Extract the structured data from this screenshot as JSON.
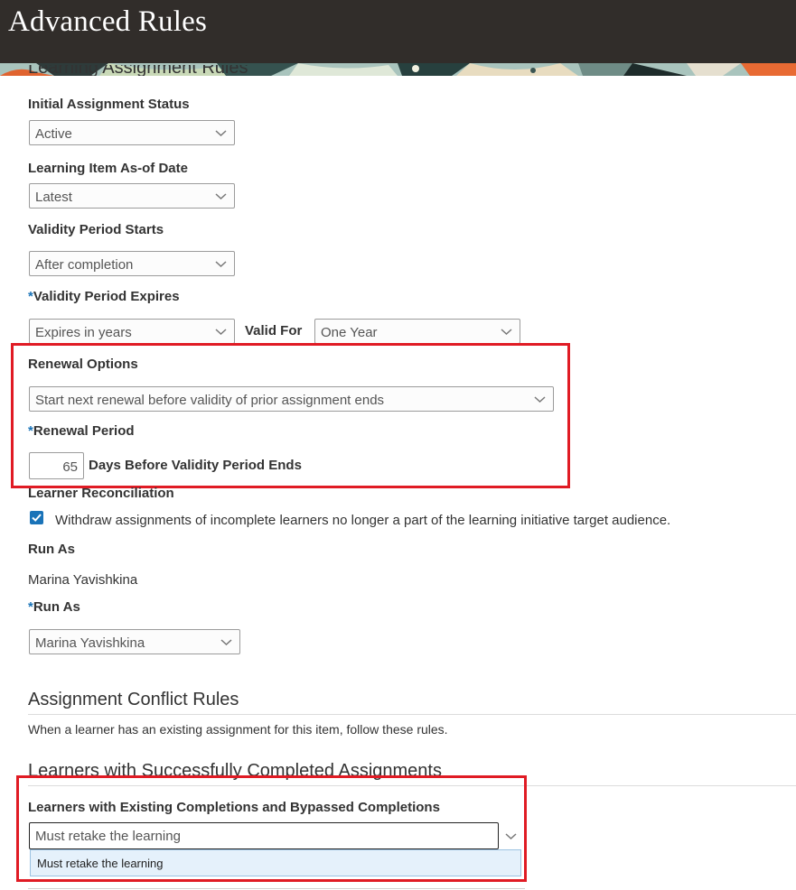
{
  "header": {
    "title": "Advanced Rules"
  },
  "sections": {
    "learning_assignment_rules": "Learning Assignment Rules",
    "assignment_conflict_rules": "Assignment Conflict Rules",
    "assignment_conflict_desc": "When a learner has an existing assignment for this item, follow these rules.",
    "learners_completed": "Learners with Successfully Completed Assignments"
  },
  "fields": {
    "initial_status": {
      "label": "Initial Assignment Status",
      "value": "Active"
    },
    "as_of_date": {
      "label": "Learning Item As-of Date",
      "value": "Latest"
    },
    "validity_starts": {
      "label": "Validity Period Starts",
      "value": "After completion"
    },
    "validity_expires": {
      "required": "*",
      "label": "Validity Period Expires",
      "value": "Expires in years"
    },
    "valid_for": {
      "label": "Valid For",
      "value": "One Year"
    },
    "renewal_options": {
      "label": "Renewal Options",
      "value": "Start next renewal before validity of prior assignment ends"
    },
    "renewal_period": {
      "required": "*",
      "label": "Renewal Period",
      "value": "65",
      "suffix": "Days Before Validity Period Ends"
    },
    "learner_reconciliation": {
      "label": "Learner Reconciliation",
      "checked": true,
      "checkbox_text": "Withdraw assignments of incomplete learners no longer a part of the learning initiative target audience."
    },
    "run_as_display": {
      "label": "Run As",
      "value": "Marina Yavishkina"
    },
    "run_as": {
      "required": "*",
      "label": "Run As",
      "value": "Marina Yavishkina"
    },
    "existing_completions": {
      "label": "Learners with Existing Completions and Bypassed Completions",
      "value": "Must retake the learning",
      "dropdown_options": [
        "Must retake the learning"
      ]
    }
  },
  "colors": {
    "header_bg": "#312d2a",
    "highlight": "#e01b24",
    "accent": "#1a73b8",
    "option_bg": "#e5f1fb"
  }
}
